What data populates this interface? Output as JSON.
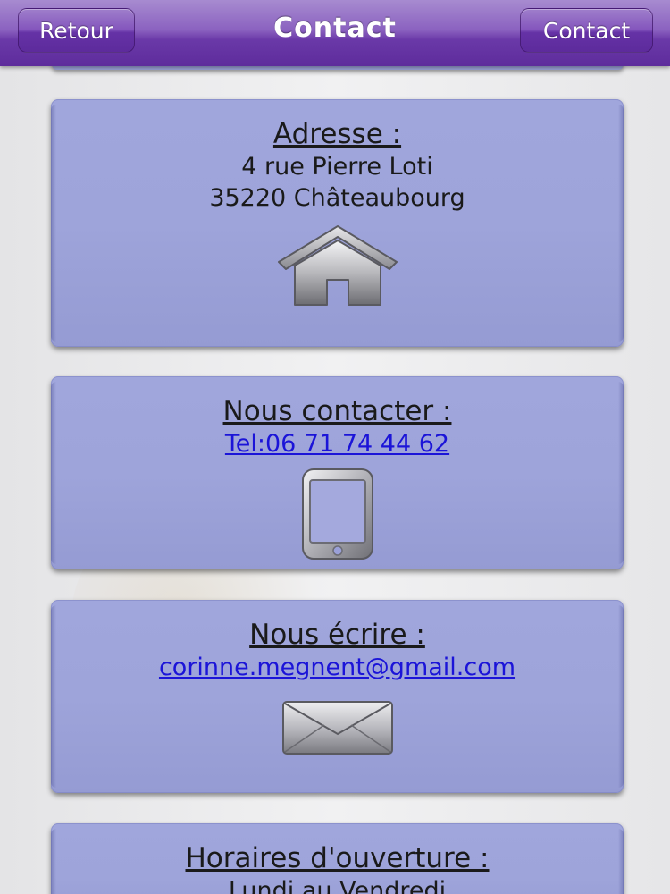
{
  "navbar": {
    "title": "Contact",
    "back_label": "Retour",
    "right_label": "Contact"
  },
  "address": {
    "title": "Adresse :",
    "line1": "4 rue Pierre Loti",
    "line2": "35220 Châteaubourg",
    "icon": "house-icon"
  },
  "phone": {
    "title": "Nous contacter :",
    "link": "Tel:06 71 74 44 62",
    "icon": "smartphone-icon"
  },
  "email": {
    "title": "Nous écrire :",
    "link": "corinne.megnent@gmail.com",
    "icon": "envelope-icon"
  },
  "hours": {
    "title": "Horaires d'ouverture :",
    "line1": "Lundi au Vendredi"
  },
  "colors": {
    "navbar": "#6a39a8",
    "card": "#9ea4da",
    "link": "#1b14d8"
  }
}
